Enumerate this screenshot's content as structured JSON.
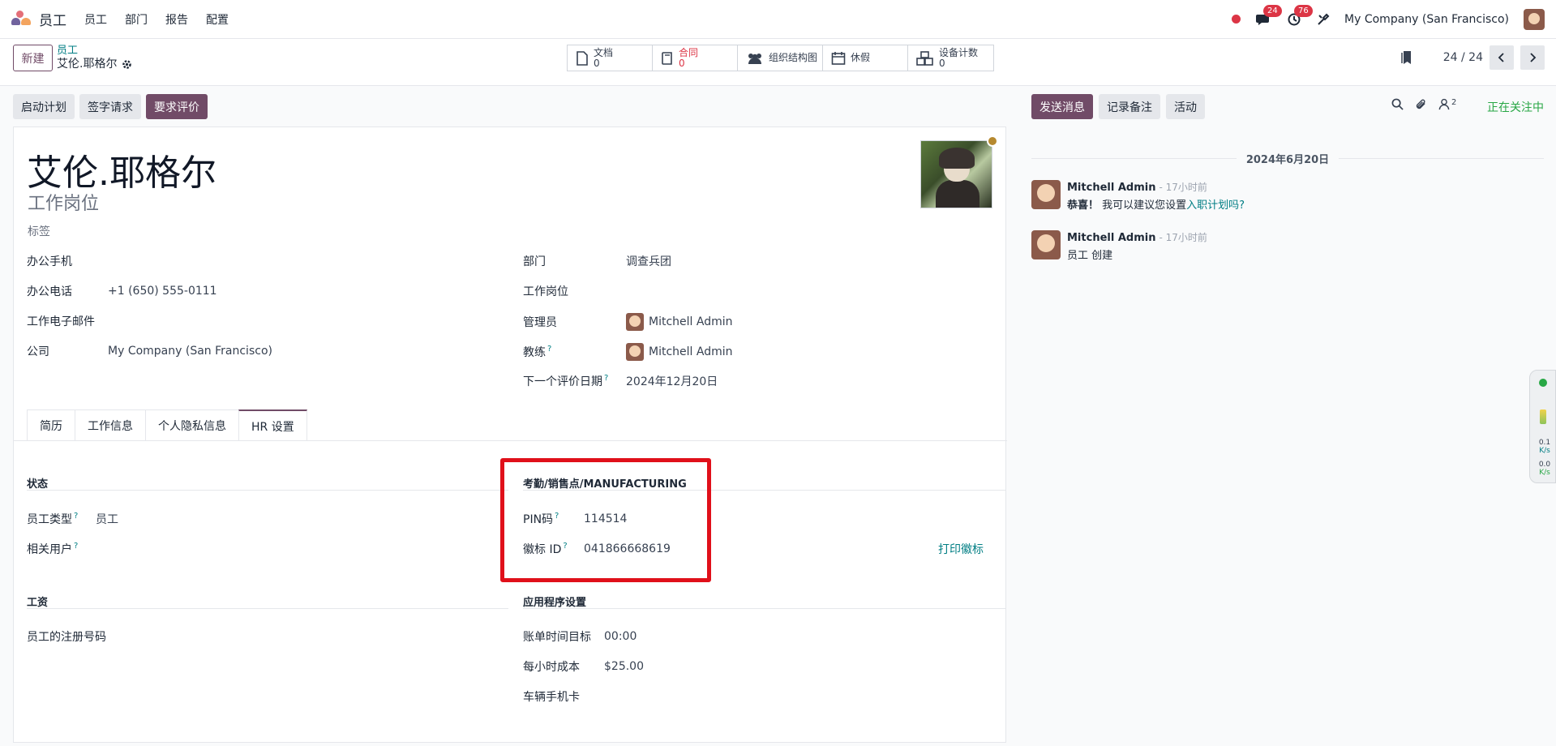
{
  "navbar": {
    "app_name": "员工",
    "menu": [
      "员工",
      "部门",
      "报告",
      "配置"
    ],
    "messages_count": "24",
    "activities_count": "76",
    "company": "My Company (San Francisco)"
  },
  "control": {
    "new_label": "新建",
    "breadcrumb_parent": "员工",
    "breadcrumb_current": "艾伦.耶格尔",
    "pager": "24 / 24"
  },
  "smart_buttons": [
    {
      "label": "文档",
      "value": "0"
    },
    {
      "label": "合同",
      "value": "0"
    },
    {
      "label": "组织结构图"
    },
    {
      "label": "休假"
    },
    {
      "label": "设备计数",
      "value": "0"
    }
  ],
  "actions": {
    "launch_plan": "启动计划",
    "sign_request": "签字请求",
    "request_appraisal": "要求评价"
  },
  "employee": {
    "name": "艾伦.耶格尔",
    "job_placeholder": "工作岗位",
    "tags_placeholder": "标签"
  },
  "fields": {
    "mobile_label": "办公手机",
    "phone_label": "办公电话",
    "phone_value": "+1 (650) 555-0111",
    "email_label": "工作电子邮件",
    "company_label": "公司",
    "company_value": "My Company (San Francisco)",
    "department_label": "部门",
    "department_value": "调查兵团",
    "job_label": "工作岗位",
    "manager_label": "管理员",
    "manager_value": "Mitchell Admin",
    "coach_label": "教练",
    "coach_value": "Mitchell Admin",
    "appraisal_label": "下一个评价日期",
    "appraisal_value": "2024年12月20日",
    "help": "?"
  },
  "tabs": [
    "简历",
    "工作信息",
    "个人隐私信息",
    "HR 设置"
  ],
  "hr": {
    "status_title": "状态",
    "emp_type_label": "员工类型",
    "emp_type_value": "员工",
    "related_user_label": "相关用户",
    "attendance_title": "考勤/销售点/MANUFACTURING",
    "pin_label": "PIN码",
    "pin_value": "114514",
    "badge_label": "徽标 ID",
    "badge_value": "041866668619",
    "print_badge": "打印徽标",
    "payroll_title": "工资",
    "registration_label": "员工的注册号码",
    "app_settings_title": "应用程序设置",
    "timesheet_label": "账单时间目标",
    "timesheet_value": "00:00",
    "hourly_cost_label": "每小时成本",
    "hourly_cost_value": "$25.00",
    "vehicle_label": "车辆手机卡"
  },
  "chatter": {
    "send_message": "发送消息",
    "log_note": "记录备注",
    "activity": "活动",
    "followers_count": "2",
    "following": "正在关注中",
    "date": "2024年6月20日",
    "messages": [
      {
        "author": "Mitchell Admin",
        "time": "- 17小时前",
        "bold": "恭喜！",
        "text": " 我可以建议您设置",
        "link": "入职计划吗?"
      },
      {
        "author": "Mitchell Admin",
        "time": "- 17小时前",
        "text": "员工 创建"
      }
    ]
  },
  "side_widget": {
    "up_value": "0.1",
    "up_unit": "K/s",
    "down_value": "0.0",
    "down_unit": "K/s"
  },
  "colors": {
    "brand": "#714b67",
    "teal": "#017e84",
    "danger": "#dc3545",
    "success": "#28a745",
    "highlight": "#e0101a"
  }
}
